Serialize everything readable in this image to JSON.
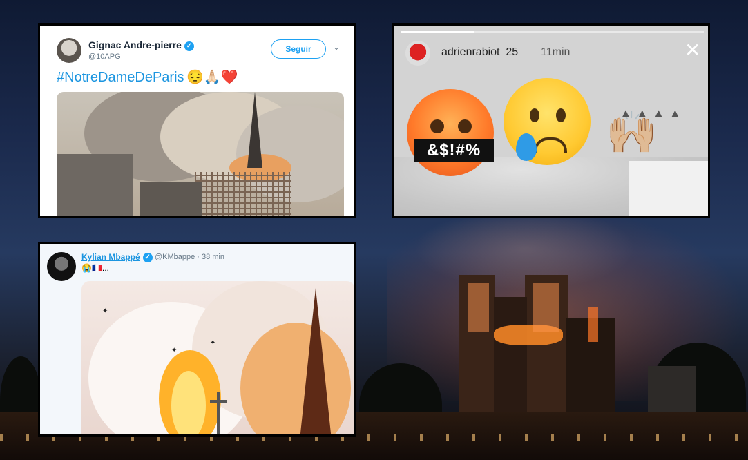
{
  "tweet1": {
    "name": "Gignac Andre-pierre",
    "handle": "@10APG",
    "follow_label": "Seguir",
    "chevron_icon": "chevron-down-icon",
    "verified_icon": "✓",
    "text": "#NotreDameDeParis",
    "emojis": "😔🙏🏻❤️"
  },
  "story": {
    "username": "adrienrabiot_25",
    "time": "11min",
    "close_icon": "✕",
    "progress": 0.24,
    "censor_text": "&$!#%",
    "hands_emoji": "🙌🏼"
  },
  "tweet2": {
    "name": "Kylian Mbappé",
    "handle": "@KMbappe · 38 min",
    "verified_icon": "✓",
    "text_emojis": "😭🇫🇷..."
  },
  "colors": {
    "twitter_blue": "#1da1f2",
    "link_blue": "#1b95e0",
    "story_bg": "#d3d3d3"
  }
}
